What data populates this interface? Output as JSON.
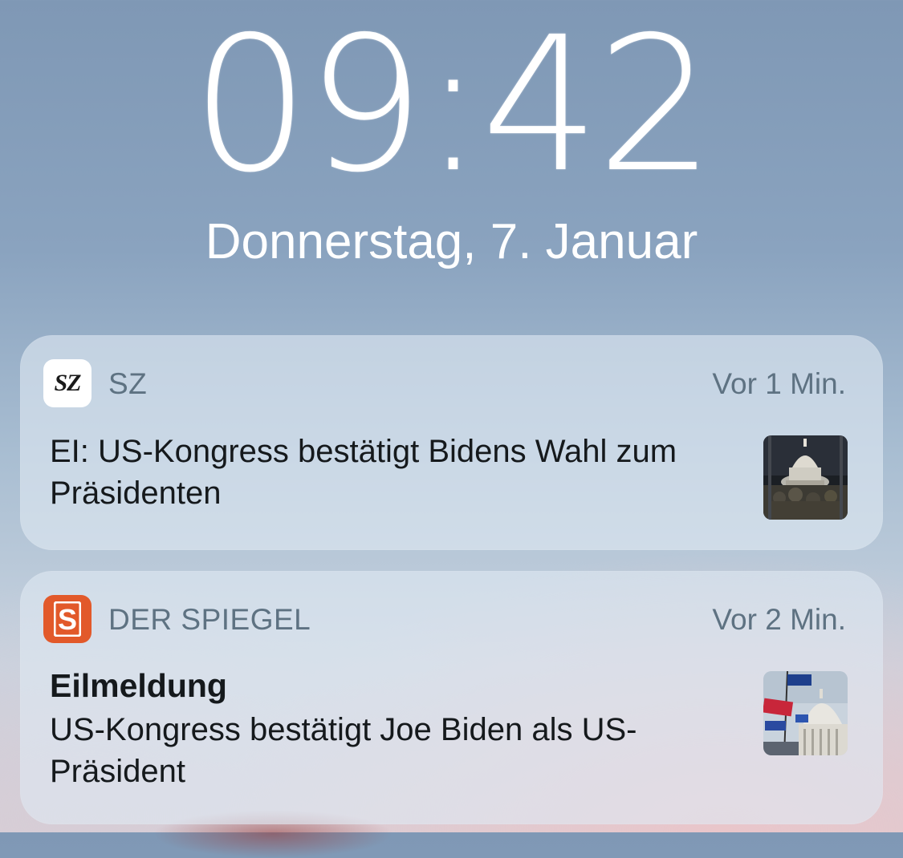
{
  "lockscreen": {
    "time": "09:42",
    "date": "Donnerstag, 7. Januar"
  },
  "notifications": [
    {
      "app_name": "SZ",
      "app_icon": "sz-logo-icon",
      "icon_text": "SZ",
      "icon_color": "#ffffff",
      "time_ago": "Vor 1 Min.",
      "title": "",
      "body": "EI: US-Kongress bestätigt Bidens Wahl zum Präsidenten",
      "thumbnail": "capitol-night-thumbnail"
    },
    {
      "app_name": "DER SPIEGEL",
      "app_icon": "spiegel-s-logo-icon",
      "icon_text": "S",
      "icon_color": "#e2592a",
      "time_ago": "Vor 2 Min.",
      "title": "Eilmeldung",
      "body": "US-Kongress bestätigt Joe Biden als US-Präsident",
      "thumbnail": "capitol-flags-thumbnail"
    }
  ]
}
